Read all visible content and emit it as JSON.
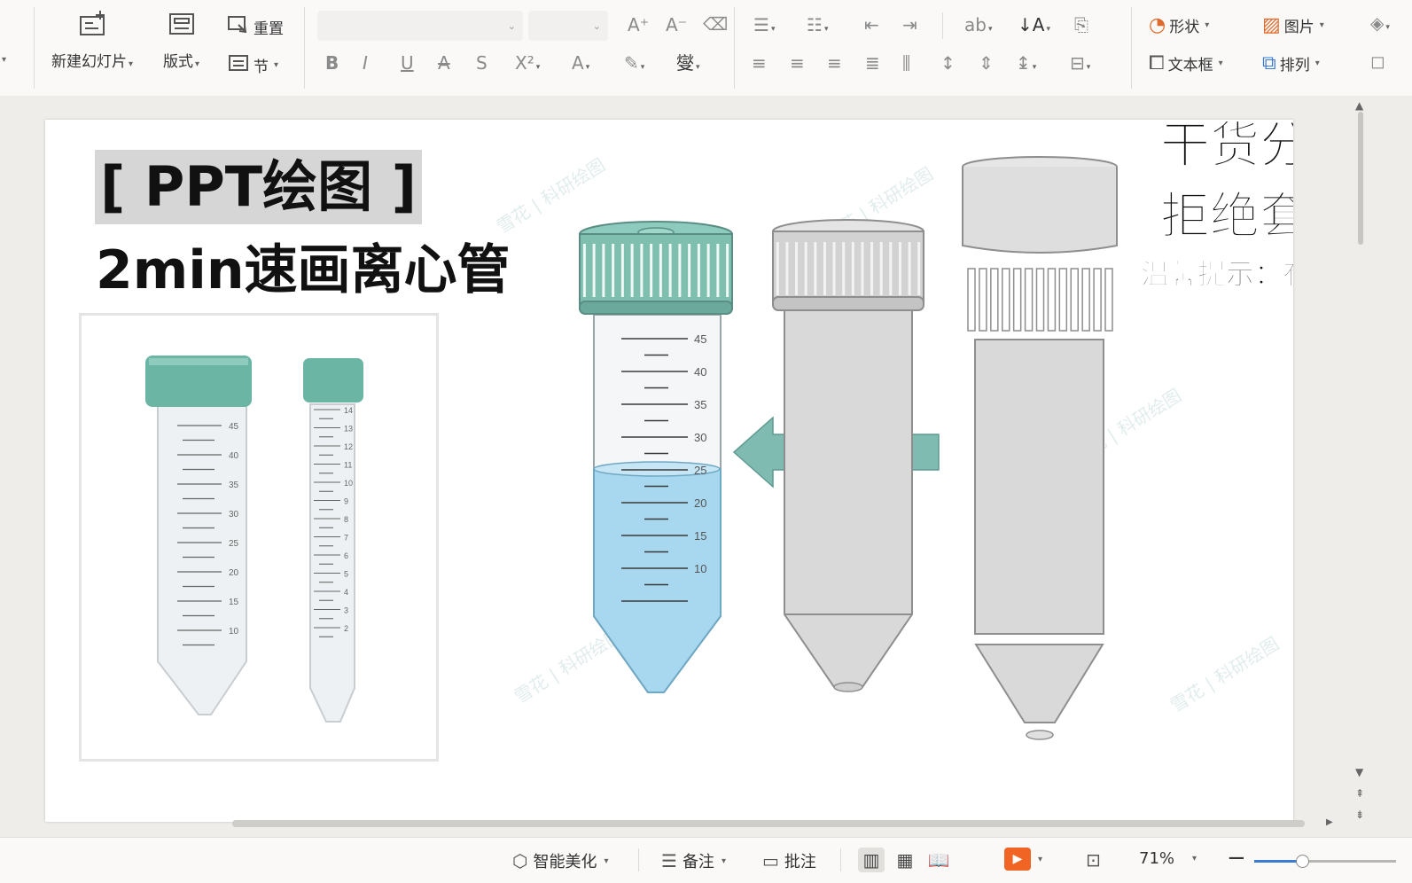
{
  "ribbon": {
    "new_slide_label": "新建幻灯片",
    "layout_label": "版式",
    "reset_label": "重置",
    "section_label": "节",
    "shape_label": "形状",
    "picture_label": "图片",
    "textbox_label": "文本框",
    "arrange_label": "排列",
    "font_name_value": "",
    "font_size_value": ""
  },
  "slide": {
    "title": "[ PPT绘图 ]",
    "subtitle": "2min速画离心管",
    "overlay_line1": "干货分享!",
    "overlay_line2": "拒绝套路!",
    "overlay_line3": "温馨提示：有声视频",
    "watermark": "雪花 | 科研绘图",
    "tube_scale_50ml": [
      "45",
      "40",
      "35",
      "30",
      "25",
      "20",
      "15",
      "10"
    ],
    "photo_scale_50ml": [
      "45",
      "40",
      "35",
      "30",
      "25",
      "20",
      "15",
      "10"
    ],
    "photo_scale_15ml": [
      "14",
      "13",
      "12",
      "11",
      "10",
      "9",
      "8",
      "7",
      "6",
      "5",
      "4",
      "3",
      "2"
    ]
  },
  "statusbar": {
    "beautify_label": "智能美化",
    "notes_label": "备注",
    "comment_label": "批注",
    "zoom_value": "71%",
    "zoom_fraction": 0.34
  },
  "colors": {
    "cap_teal": "#7fbfb0",
    "liquid_blue": "#a8d8ef",
    "arrow_teal": "#80bbb1",
    "grey_fill": "#d9d9d9",
    "accent_orange": "#f06523"
  }
}
